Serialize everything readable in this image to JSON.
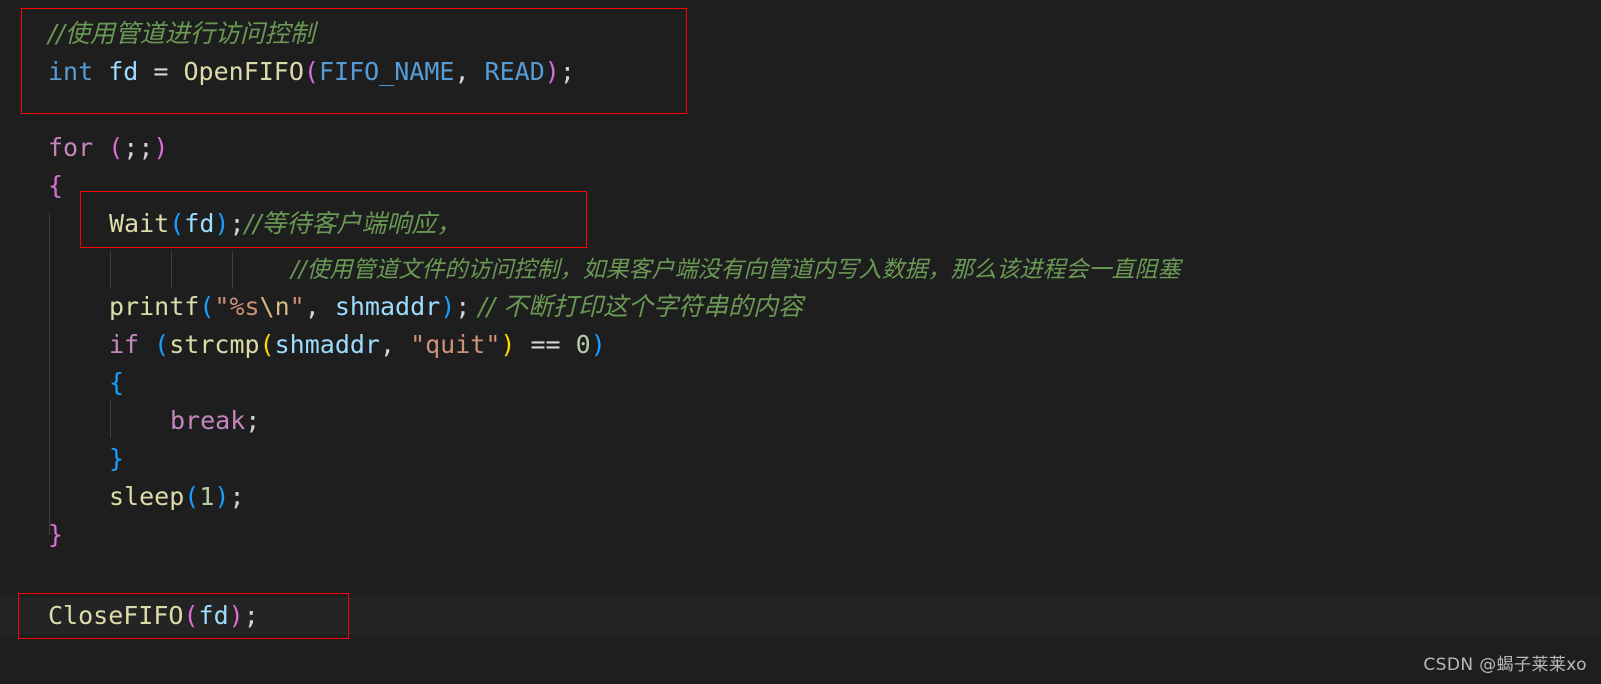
{
  "editor": {
    "background_color": "#1e1e1e",
    "current_line_color": "#242424",
    "font_size_px": 25,
    "line_height_px": 38
  },
  "code": {
    "line1_comment": "//使用管道进行访问控制",
    "line2": {
      "keyword_int": "int",
      "space1": " ",
      "var_fd": "fd",
      "equals": " = ",
      "func_openfifo": "OpenFIFO",
      "paren_open": "(",
      "macro_fifo_name": "FIFO_NAME",
      "comma": ", ",
      "macro_read": "READ",
      "paren_close": ")",
      "semicolon": ";"
    },
    "line3": {
      "control_for": "for",
      "space": " ",
      "paren_open": "(",
      "semis": ";;",
      "paren_close": ")"
    },
    "line4_brace_open": "{",
    "line5": {
      "func_wait": "Wait",
      "paren_open": "(",
      "var_fd": "fd",
      "paren_close": ")",
      "semicolon": ";",
      "comment": "//等待客户端响应，"
    },
    "line6_comment": "//使用管道文件的访问控制，如果客户端没有向管道内写入数据，那么该进程会一直阻塞",
    "line7": {
      "func_printf": "printf",
      "paren_open": "(",
      "quote_open": "\"",
      "fmt_percent_s": "%s",
      "fmt_newline": "\\n",
      "quote_close": "\"",
      "comma": ", ",
      "var_shmaddr": "shmaddr",
      "paren_close": ")",
      "semicolon": ";",
      "comment": " // 不断打印这个字符串的内容"
    },
    "line8": {
      "control_if": "if",
      "space": " ",
      "paren_open": "(",
      "func_strcmp": "strcmp",
      "paren_open2": "(",
      "var_shmaddr": "shmaddr",
      "comma": ", ",
      "string_quit": "\"quit\"",
      "paren_close2": ")",
      "equals_equals": " == ",
      "number_zero": "0",
      "paren_close": ")"
    },
    "line9_brace_open": "{",
    "line10": {
      "control_break": "break",
      "semicolon": ";"
    },
    "line11_brace_close": "}",
    "line12": {
      "func_sleep": "sleep",
      "paren_open": "(",
      "number_one": "1",
      "paren_close": ")",
      "semicolon": ";"
    },
    "line13_brace_close": "}",
    "line14": {
      "func_closefifo": "CloseFIFO",
      "paren_open": "(",
      "var_fd": "fd",
      "paren_close": ")",
      "semicolon": ";"
    }
  },
  "annotations": {
    "box1_label": "open-fifo-block",
    "box2_label": "wait-call-block",
    "box3_label": "close-fifo-block",
    "border_color": "#fb0007"
  },
  "watermark": {
    "text": "CSDN @蝎子莱莱xo",
    "color": "#b9b9b9"
  },
  "token_colors": {
    "comment": "#6a9955",
    "keyword": "#569cd6",
    "control": "#c586c0",
    "function": "#dcdcaa",
    "variable": "#9cdcfe",
    "string": "#ce9178",
    "number": "#b5cea8",
    "plain": "#d4d4d4",
    "bracket_level1": "#da70d6",
    "bracket_level2": "#179fff",
    "bracket_level3": "#ffd700"
  }
}
